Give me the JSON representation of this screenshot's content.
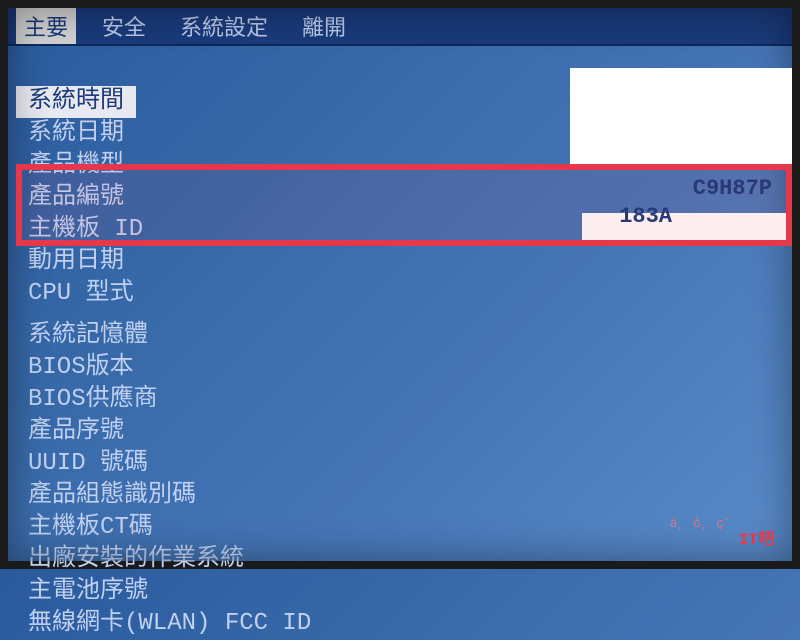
{
  "menu": {
    "items": [
      "主要",
      "安全",
      "系統設定",
      "離開"
    ],
    "selected_index": 0
  },
  "rows": [
    {
      "label": "系統時間",
      "highlighted": true
    },
    {
      "label": "系統日期"
    },
    {
      "label": "產品機型"
    },
    {
      "label": "產品編號",
      "value": "C9H87P"
    },
    {
      "label": "主機板 ID",
      "value": "183A"
    },
    {
      "label": "動用日期"
    },
    {
      "label": "CPU 型式"
    },
    {
      "label": ""
    },
    {
      "label": "系統記憶體"
    },
    {
      "label": "BIOS版本"
    },
    {
      "label": "BIOS供應商"
    },
    {
      "label": "產品序號"
    },
    {
      "label": "UUID 號碼"
    },
    {
      "label": "產品組態識別碼"
    },
    {
      "label": "主機板CT碼"
    },
    {
      "label": "出廠安裝的作業系統"
    },
    {
      "label": "主電池序號"
    },
    {
      "label": "無線網卡(WLAN) FCC ID"
    }
  ],
  "watermark": {
    "chars": "ä¸ č¸ ç˝",
    "brand": "IT吧"
  }
}
